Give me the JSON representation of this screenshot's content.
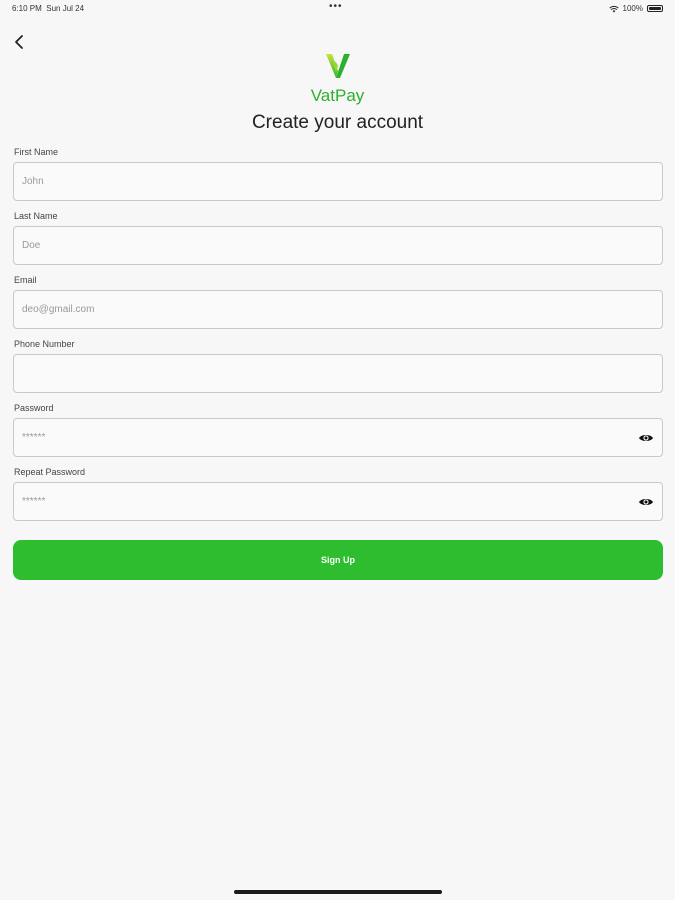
{
  "status_bar": {
    "time": "6:10 PM",
    "date": "Sun Jul 24",
    "dots": "•••",
    "battery": "100%"
  },
  "brand": {
    "name": "VatPay",
    "color": "#2bb12b"
  },
  "page": {
    "title": "Create your account"
  },
  "form": {
    "fields": [
      {
        "label": "First Name",
        "placeholder": "John",
        "type": "text"
      },
      {
        "label": "Last Name",
        "placeholder": "Doe",
        "type": "text"
      },
      {
        "label": "Email",
        "placeholder": "deo@gmail.com",
        "type": "email"
      },
      {
        "label": "Phone Number",
        "placeholder": "",
        "type": "tel"
      },
      {
        "label": "Password",
        "placeholder": "******",
        "type": "password",
        "icon": "eye-icon"
      },
      {
        "label": "Repeat Password",
        "placeholder": "******",
        "type": "password",
        "icon": "eye-icon"
      }
    ],
    "submit_label": "Sign Up",
    "submit_color": "#2ebd2e"
  },
  "icons": {
    "back": "chevron-left-icon",
    "wifi": "wifi-icon",
    "battery": "battery-icon",
    "logo": "vatpay-logo-icon"
  }
}
